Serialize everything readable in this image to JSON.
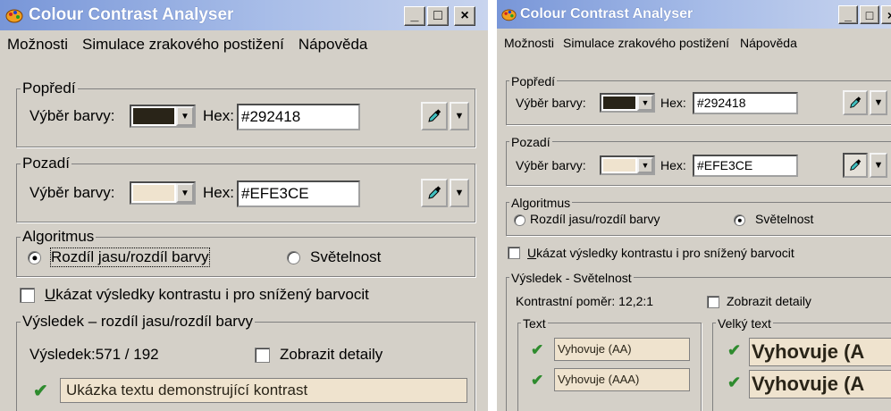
{
  "title": "Colour Contrast Analyser",
  "caption_buttons": {
    "minimize": "_",
    "maximize": "□",
    "close": "×"
  },
  "menu": [
    "Možnosti",
    "Simulace zrakového postižení",
    "Nápověda"
  ],
  "colors": {
    "foreground": "#292418",
    "background": "#EFE3CE",
    "title_start": "#7896d8",
    "check_green": "#2e8b2e"
  },
  "foreground": {
    "legend": "Popředí",
    "picker_label": "Výběr barvy:",
    "hex_label": "Hex:",
    "hex_value": "#292418"
  },
  "background": {
    "legend": "Pozadí",
    "picker_label": "Výběr barvy:",
    "hex_label": "Hex:",
    "hex_value": "#EFE3CE"
  },
  "algorithm": {
    "legend": "Algoritmus",
    "option1": "Rozdíl jasu/rozdíl barvy",
    "option2": "Světelnost"
  },
  "colorblind": {
    "label_first": "U",
    "label_rest": "kázat výsledky kontrastu i pro snížený barvocit"
  },
  "left_window": {
    "selected_algorithm": "option1",
    "result": {
      "legend": "Výsledek – rozdíl jasu/rozdíl barvy",
      "label": "Výsledek:571 / 192",
      "details_label": "Zobrazit detaily",
      "sample_text": "Ukázka textu demonstrující kontrast"
    }
  },
  "right_window": {
    "selected_algorithm": "option2",
    "result": {
      "legend": "Výsledek - Světelnost",
      "ratio_label": "Kontrastní poměr: 12,2:1",
      "details_label": "Zobrazit detaily",
      "text_group": {
        "legend": "Text",
        "items": [
          "Vyhovuje (AA)",
          "Vyhovuje (AAA)"
        ]
      },
      "large_text_group": {
        "legend": "Velký text",
        "items": [
          "Vyhovuje (A",
          "Vyhovuje (A"
        ]
      }
    }
  },
  "icons": [
    "app-palette-icon",
    "eyedropper-icon",
    "dropdown-arrow-icon",
    "check-icon"
  ]
}
